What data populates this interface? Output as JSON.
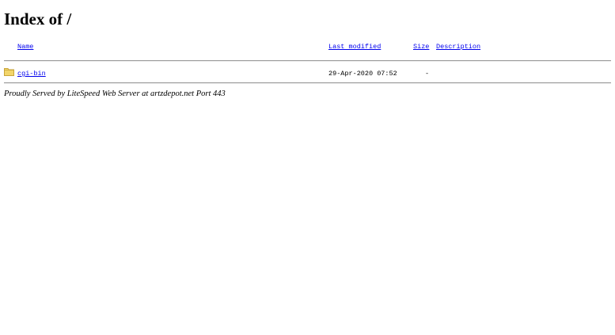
{
  "page": {
    "title": "Index of /"
  },
  "table": {
    "headers": {
      "name": "Name",
      "last_modified": "Last modified",
      "size": "Size",
      "description": "Description"
    },
    "rows": [
      {
        "icon": "folder-icon",
        "name": "cgi-bin",
        "last_modified": "29-Apr-2020 07:52",
        "size": "-",
        "description": ""
      }
    ]
  },
  "footer": {
    "text": "Proudly Served by LiteSpeed Web Server at artzdepot.net Port 443"
  },
  "colors": {
    "link": "#0000ee",
    "folder": "#f2d56a",
    "folder_outline": "#c9a53a",
    "rule": "#9a9a9a"
  }
}
